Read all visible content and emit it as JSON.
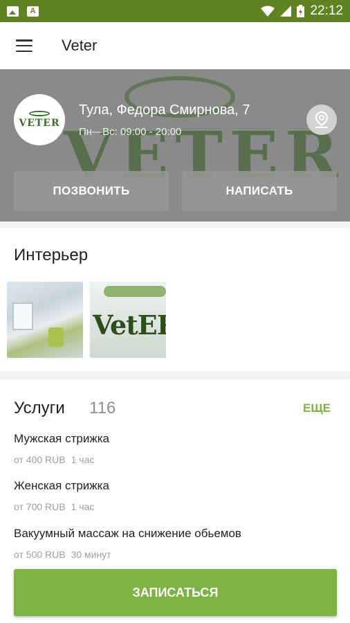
{
  "status_bar": {
    "time": "22:12"
  },
  "app_bar": {
    "title": "Veter"
  },
  "hero": {
    "logo_text": "VETER",
    "background_text": "VETER",
    "address": "Тула, Федора Смирнова, 7",
    "hours": "Пн—Вс: 09:00 - 20:00",
    "call_label": "ПОЗВОНИТЬ",
    "write_label": "НАПИСАТЬ"
  },
  "interior": {
    "title": "Интерьер",
    "photo2_text": "VetER"
  },
  "services": {
    "title": "Услуги",
    "count": "116",
    "more_label": "ЕЩЕ",
    "items": [
      {
        "name": "Мужская стрижка",
        "price": "от 400 RUB",
        "duration": "1 час"
      },
      {
        "name": "Женская стрижка",
        "price": "от 700 RUB",
        "duration": "1 час"
      },
      {
        "name": "Вакуумный массаж на снижение обьемов",
        "price": "от 500 RUB",
        "duration": "30 минут"
      }
    ],
    "book_label": "ЗАПИСАТЬСЯ"
  },
  "colors": {
    "accent": "#7cb342",
    "status_bar": "#5e8320"
  }
}
